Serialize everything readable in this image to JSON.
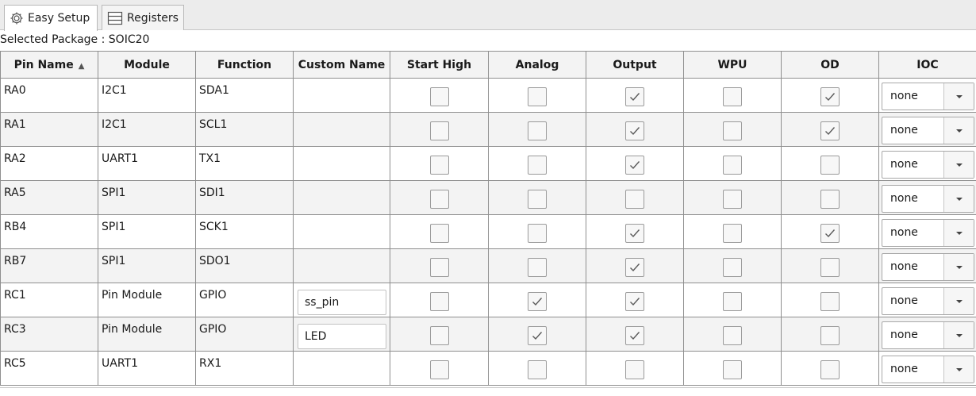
{
  "tabs": [
    {
      "label": "Easy Setup",
      "icon": "gear-icon",
      "active": true
    },
    {
      "label": "Registers",
      "icon": "registers-icon",
      "active": false
    }
  ],
  "package_label": "Selected Package : SOIC20",
  "columns": {
    "pin_name": "Pin Name",
    "sort_indicator": "▲",
    "module": "Module",
    "function": "Function",
    "custom_name": "Custom Name",
    "start_high": "Start High",
    "analog": "Analog",
    "output": "Output",
    "wpu": "WPU",
    "od": "OD",
    "ioc": "IOC"
  },
  "rows": [
    {
      "pin": "RA0",
      "module": "I2C1",
      "function": "SDA1",
      "custom_name": "",
      "start_high": false,
      "analog": false,
      "output": true,
      "wpu": false,
      "od": true,
      "ioc": "none"
    },
    {
      "pin": "RA1",
      "module": "I2C1",
      "function": "SCL1",
      "custom_name": "",
      "start_high": false,
      "analog": false,
      "output": true,
      "wpu": false,
      "od": true,
      "ioc": "none"
    },
    {
      "pin": "RA2",
      "module": "UART1",
      "function": "TX1",
      "custom_name": "",
      "start_high": false,
      "analog": false,
      "output": true,
      "wpu": false,
      "od": false,
      "ioc": "none"
    },
    {
      "pin": "RA5",
      "module": "SPI1",
      "function": "SDI1",
      "custom_name": "",
      "start_high": false,
      "analog": false,
      "output": false,
      "wpu": false,
      "od": false,
      "ioc": "none"
    },
    {
      "pin": "RB4",
      "module": "SPI1",
      "function": "SCK1",
      "custom_name": "",
      "start_high": false,
      "analog": false,
      "output": true,
      "wpu": false,
      "od": true,
      "ioc": "none"
    },
    {
      "pin": "RB7",
      "module": "SPI1",
      "function": "SDO1",
      "custom_name": "",
      "start_high": false,
      "analog": false,
      "output": true,
      "wpu": false,
      "od": false,
      "ioc": "none"
    },
    {
      "pin": "RC1",
      "module": "Pin Module",
      "function": "GPIO",
      "custom_name": "ss_pin",
      "start_high": false,
      "analog": true,
      "output": true,
      "wpu": false,
      "od": false,
      "ioc": "none"
    },
    {
      "pin": "RC3",
      "module": "Pin Module",
      "function": "GPIO",
      "custom_name": "LED",
      "start_high": false,
      "analog": true,
      "output": true,
      "wpu": false,
      "od": false,
      "ioc": "none"
    },
    {
      "pin": "RC5",
      "module": "UART1",
      "function": "RX1",
      "custom_name": "",
      "start_high": false,
      "analog": false,
      "output": false,
      "wpu": false,
      "od": false,
      "ioc": "none"
    }
  ],
  "colors": {
    "check": "#5a5a5a",
    "row_alt": "#f3f3f3"
  }
}
